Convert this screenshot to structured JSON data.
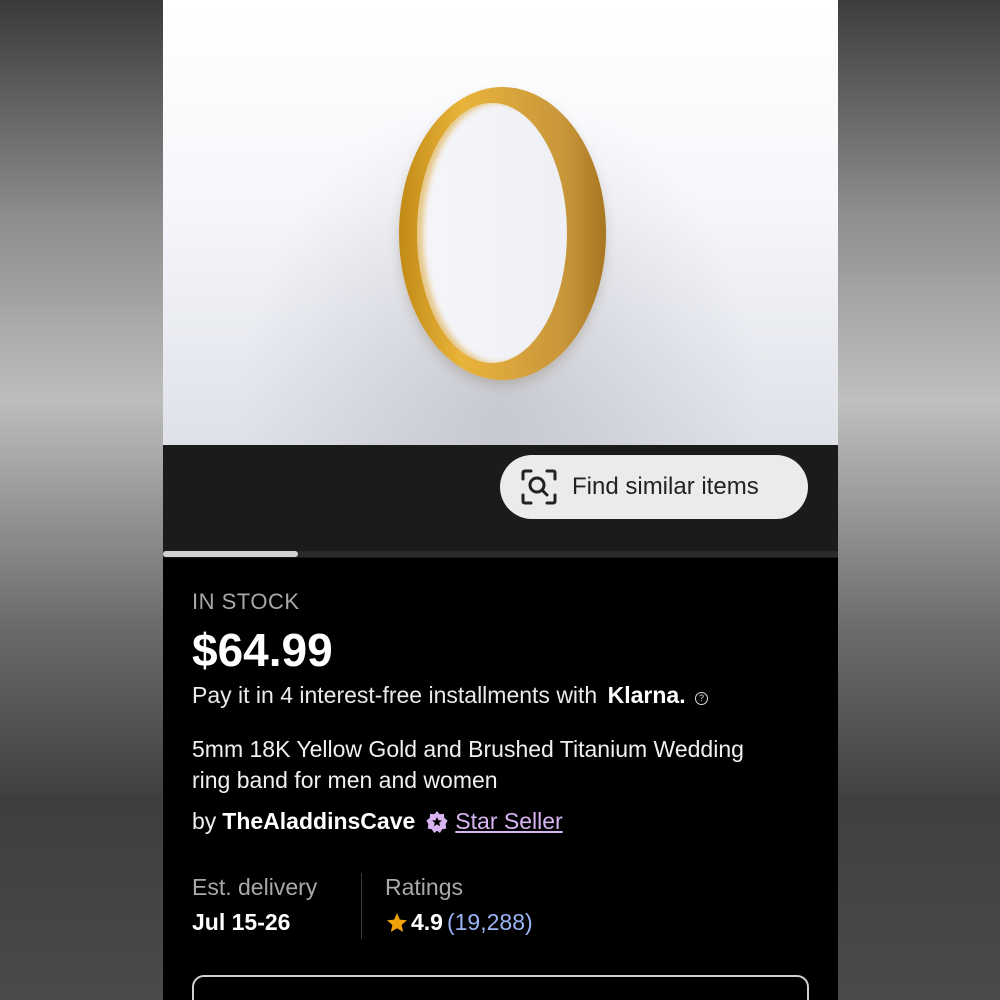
{
  "product_image": {
    "alt": "5mm 18K Yellow Gold and Brushed Titanium Wedding ring band"
  },
  "gallery": {
    "find_similar_label": "Find similar items",
    "position_fraction": 0.2
  },
  "listing": {
    "stock_status": "IN STOCK",
    "price": "$64.99",
    "installments_text": "Pay it in 4 interest-free installments with",
    "installments_brand": "Klarna.",
    "title": "5mm 18K Yellow Gold and Brushed Titanium Wedding ring band for men and women",
    "seller_prefix": "by",
    "seller_name": "TheAladdinsCave",
    "seller_badge": "Star Seller"
  },
  "delivery": {
    "label": "Est. delivery",
    "value": "Jul 15-26"
  },
  "ratings": {
    "label": "Ratings",
    "score": "4.9",
    "count": "(19,288)"
  },
  "colors": {
    "accent_star": "#f1a10a",
    "star_seller": "#d8b4f2",
    "link_blue": "#9ab6f5"
  }
}
